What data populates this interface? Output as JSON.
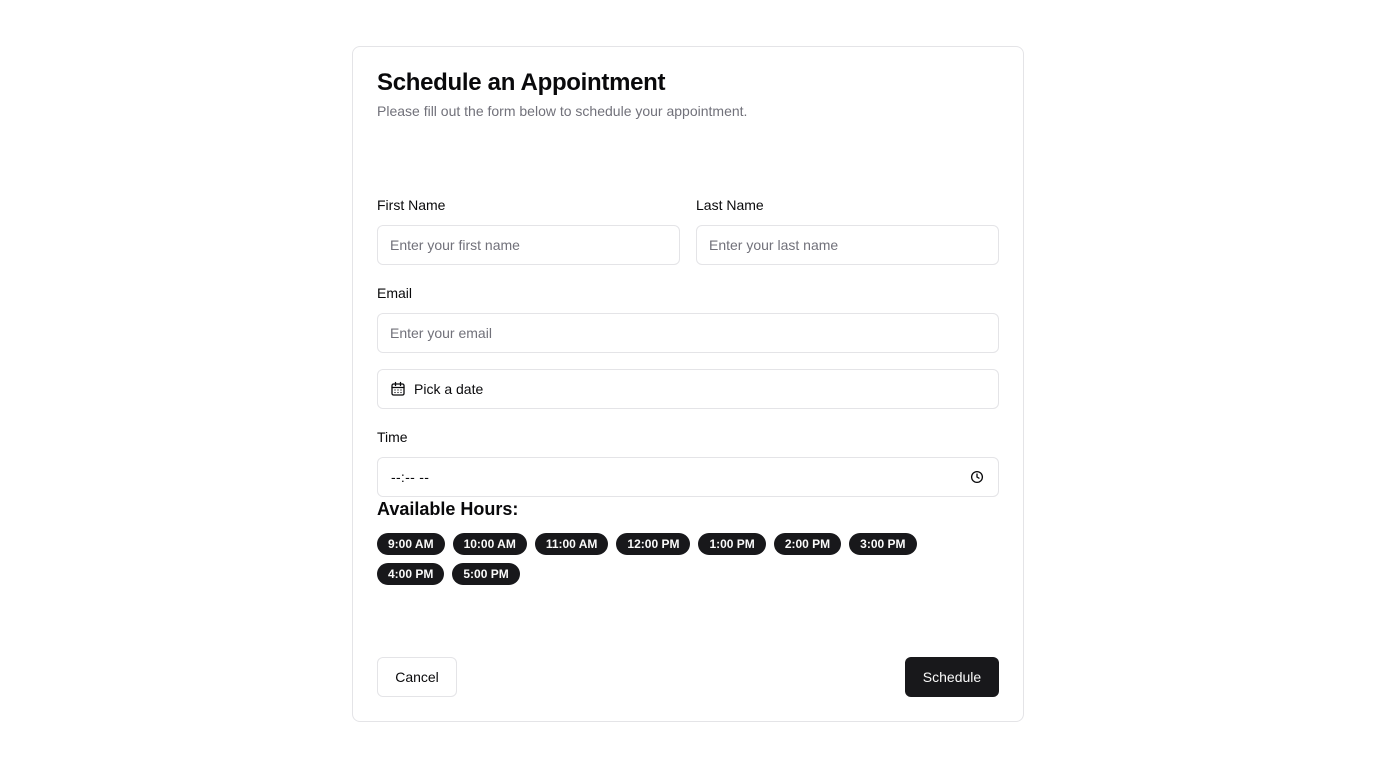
{
  "form": {
    "title": "Schedule an Appointment",
    "subtitle": "Please fill out the form below to schedule your appointment.",
    "first_name": {
      "label": "First Name",
      "value": "",
      "placeholder": "Enter your first name"
    },
    "last_name": {
      "label": "Last Name",
      "value": "",
      "placeholder": "Enter your last name"
    },
    "email": {
      "label": "Email",
      "value": "",
      "placeholder": "Enter your email"
    },
    "date": {
      "text": "Pick a date",
      "icon": "calendar-icon"
    },
    "time": {
      "label": "Time",
      "value": "--:-- --",
      "icon": "clock-icon"
    },
    "hours_heading": "Available Hours:",
    "hours": [
      "9:00 AM",
      "10:00 AM",
      "11:00 AM",
      "12:00 PM",
      "1:00 PM",
      "2:00 PM",
      "3:00 PM",
      "4:00 PM",
      "5:00 PM"
    ],
    "cancel_label": "Cancel",
    "schedule_label": "Schedule"
  },
  "colors": {
    "primary": "#18181b",
    "primary_text": "#fafafa",
    "muted_text": "#71717a",
    "border": "#e4e4e7"
  }
}
